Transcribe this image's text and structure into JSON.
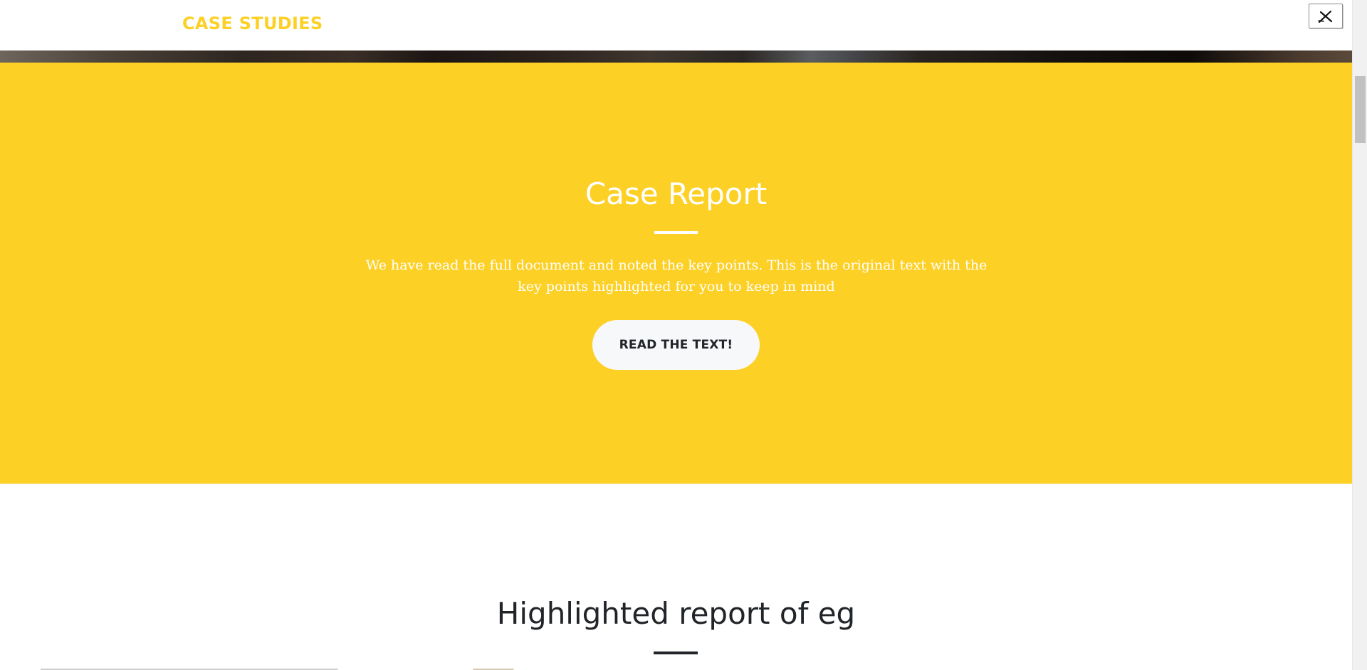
{
  "navbar": {
    "brand": "CASE STUDIES"
  },
  "masthead": {
    "title": "Case Report",
    "text": "We have read the full document and noted the key points. This is the original text with the key points highlighted for you to keep in mind",
    "button_label": "READ THE TEXT!"
  },
  "report": {
    "title": "Highlighted report of eg"
  },
  "icons": {
    "close": "close-icon"
  },
  "colors": {
    "accent": "#fdd026",
    "button_bg": "#f7f8fa",
    "dark_text": "#212529",
    "white": "#ffffff"
  }
}
